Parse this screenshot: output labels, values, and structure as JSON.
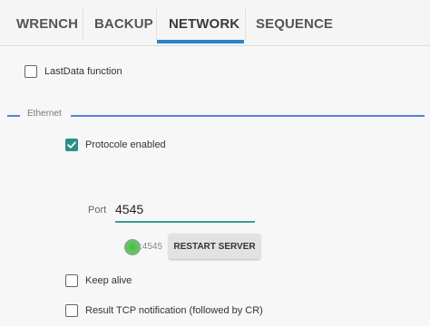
{
  "tabs": [
    {
      "label": "WRENCH",
      "active": false
    },
    {
      "label": "BACKUP",
      "active": false
    },
    {
      "label": "NETWORK",
      "active": true
    },
    {
      "label": "SEQUENCE",
      "active": false
    }
  ],
  "accent_color": "#2b84c6",
  "checkbox_color": "#2a8f8a",
  "section_line_color": "#5b7fd6",
  "lastdata": {
    "label": "LastData function",
    "checked": false
  },
  "ethernet": {
    "section_title": "Ethernet",
    "protocol": {
      "label": "Protocole enabled",
      "checked": true
    },
    "port": {
      "label": "Port",
      "value": "4545"
    },
    "server": {
      "status_port": ":4545",
      "restart_label": "RESTART SERVER",
      "status_color": "#3fbf3f"
    },
    "keep_alive": {
      "label": "Keep alive",
      "checked": false
    },
    "result_tcp": {
      "label": "Result TCP notification (followed by CR)",
      "checked": false
    }
  }
}
